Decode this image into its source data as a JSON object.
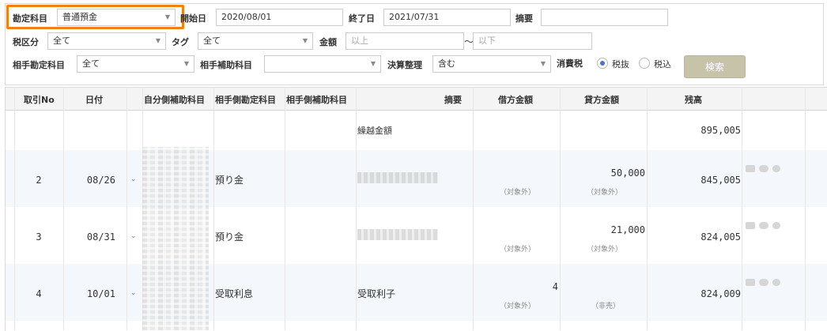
{
  "filters": {
    "account_label": "勘定科目",
    "account_value": "普通預金",
    "start_label": "開始日",
    "start_value": "2020/08/01",
    "end_label": "終了日",
    "end_value": "2021/07/31",
    "memo_label": "摘要",
    "memo_value": "",
    "tax_class_label": "税区分",
    "tax_class_value": "全て",
    "tag_label": "タグ",
    "tag_value": "全て",
    "amount_label": "金額",
    "amount_min_placeholder": "以上",
    "amount_sep": "〜",
    "amount_max_placeholder": "以下",
    "counter_account_label": "相手勘定科目",
    "counter_account_value": "全て",
    "counter_sub_label": "相手補助科目",
    "counter_sub_value": "",
    "closing_label": "決算整理",
    "closing_value": "含む",
    "tax_label": "消費税",
    "tax_excl_label": "税抜",
    "tax_incl_label": "税込",
    "tax_selected": "税抜",
    "search_button": "検索"
  },
  "table": {
    "headers": [
      "取引No",
      "日付",
      "自分側補助科目",
      "相手側勘定科目",
      "相手側補助科目",
      "摘要",
      "借方金額",
      "貸方金額",
      "残高"
    ],
    "carry": {
      "memo": "繰越金額",
      "balance": "895,005"
    },
    "rows": [
      {
        "no": "2",
        "date": "08/26",
        "counter_account": "預り金",
        "memo": "",
        "debit": "",
        "credit": "50,000",
        "debit_note": "（対象外）",
        "credit_note": "（対象外）",
        "balance": "845,005"
      },
      {
        "no": "3",
        "date": "08/31",
        "counter_account": "預り金",
        "memo": "",
        "debit": "",
        "credit": "21,000",
        "debit_note": "（対象外）",
        "credit_note": "（対象外）",
        "balance": "824,005"
      },
      {
        "no": "4",
        "date": "10/01",
        "counter_account": "受取利息",
        "memo": "受取利子",
        "debit": "4",
        "credit": "",
        "debit_note": "（対象外）",
        "credit_note": "（非売）",
        "balance": "824,009"
      }
    ]
  }
}
